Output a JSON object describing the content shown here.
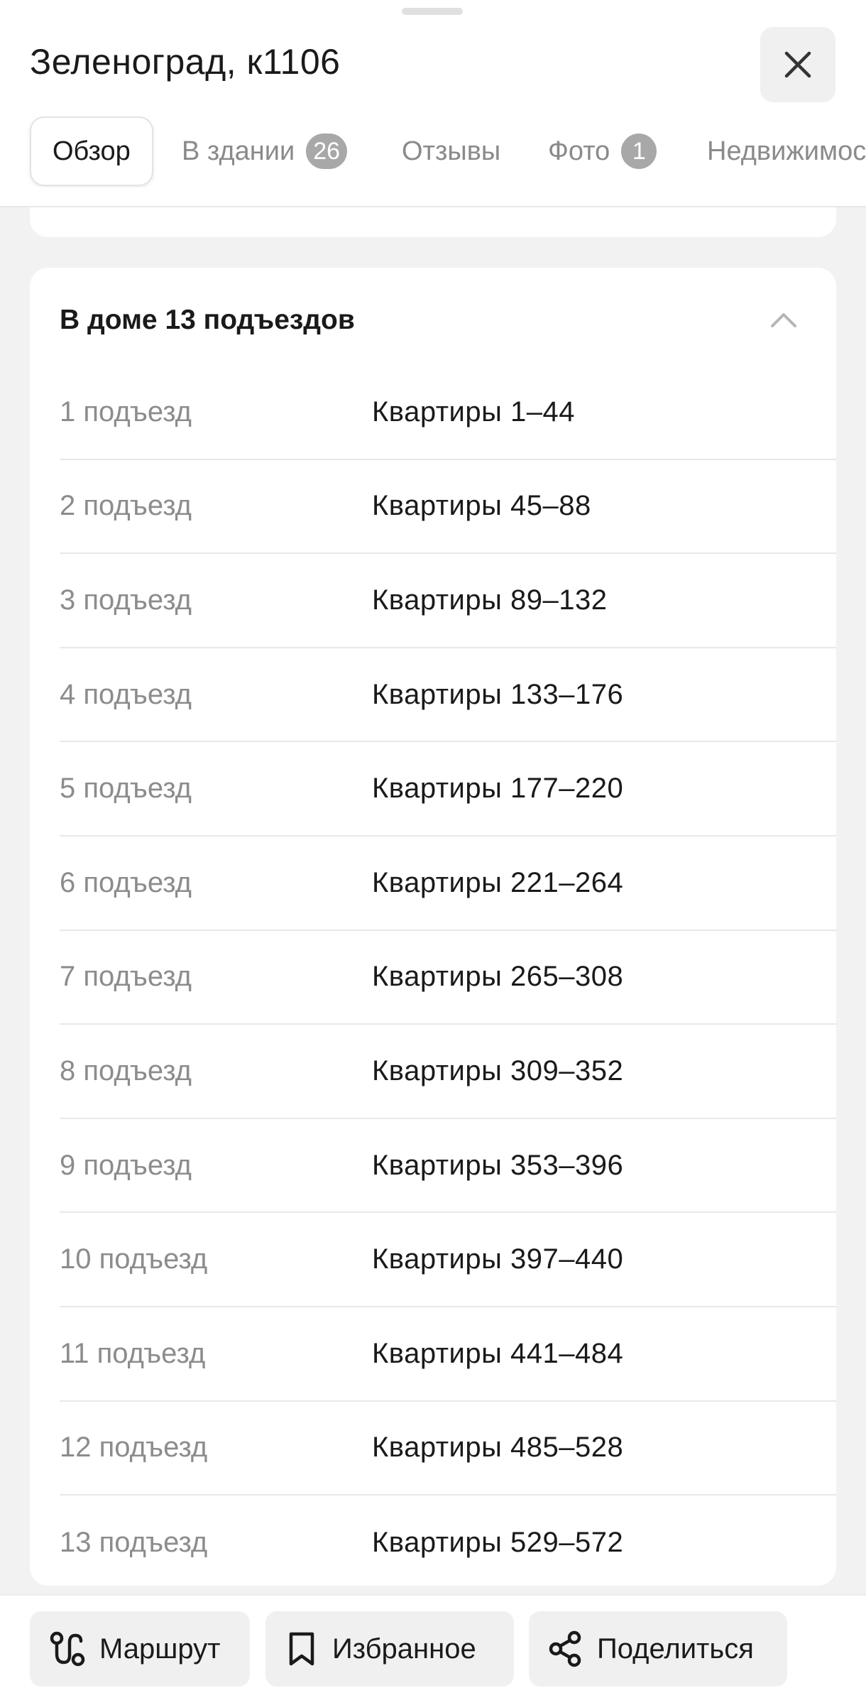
{
  "header": {
    "title": "Зеленоград, к1106",
    "close_icon": "close-icon"
  },
  "tabs": [
    {
      "label": "Обзор",
      "active": true
    },
    {
      "label": "В здании",
      "badge": "26"
    },
    {
      "label": "Отзывы"
    },
    {
      "label": "Фото",
      "badge": "1"
    },
    {
      "label": "Недвижимос"
    }
  ],
  "entrances": {
    "title": "В доме 13 подъездов",
    "collapse_icon": "chevron-up-icon",
    "rows": [
      {
        "entrance": "1 подъезд",
        "flats": "Квартиры 1–44"
      },
      {
        "entrance": "2 подъезд",
        "flats": "Квартиры 45–88"
      },
      {
        "entrance": "3 подъезд",
        "flats": "Квартиры 89–132"
      },
      {
        "entrance": "4 подъезд",
        "flats": "Квартиры 133–176"
      },
      {
        "entrance": "5 подъезд",
        "flats": "Квартиры 177–220"
      },
      {
        "entrance": "6 подъезд",
        "flats": "Квартиры 221–264"
      },
      {
        "entrance": "7 подъезд",
        "flats": "Квартиры 265–308"
      },
      {
        "entrance": "8 подъезд",
        "flats": "Квартиры 309–352"
      },
      {
        "entrance": "9 подъезд",
        "flats": "Квартиры 353–396"
      },
      {
        "entrance": "10 подъезд",
        "flats": "Квартиры 397–440"
      },
      {
        "entrance": "11 подъезд",
        "flats": "Квартиры 441–484"
      },
      {
        "entrance": "12 подъезд",
        "flats": "Квартиры 485–528"
      },
      {
        "entrance": "13 подъезд",
        "flats": "Квартиры 529–572"
      }
    ]
  },
  "bottom_bar": {
    "route_label": "Маршрут",
    "route_icon": "route-icon",
    "favorites_label": "Избранное",
    "favorites_icon": "bookmark-icon",
    "share_label": "Поделиться",
    "share_icon": "share-icon"
  },
  "colors": {
    "background": "#f2f2f2",
    "card": "#ffffff",
    "secondary_text": "#8c8c8c",
    "badge": "#a8a8a8"
  }
}
